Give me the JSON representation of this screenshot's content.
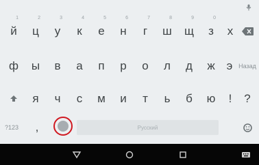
{
  "keyboard": {
    "row1": [
      {
        "label": "й",
        "hint": "1"
      },
      {
        "label": "ц",
        "hint": "2"
      },
      {
        "label": "у",
        "hint": "3"
      },
      {
        "label": "к",
        "hint": "4"
      },
      {
        "label": "е",
        "hint": "5"
      },
      {
        "label": "н",
        "hint": "6"
      },
      {
        "label": "г",
        "hint": "7"
      },
      {
        "label": "ш",
        "hint": "8"
      },
      {
        "label": "щ",
        "hint": "9"
      },
      {
        "label": "з",
        "hint": "0"
      },
      {
        "label": "х",
        "hint": ""
      }
    ],
    "row2": [
      "ф",
      "ы",
      "в",
      "а",
      "п",
      "р",
      "о",
      "л",
      "д",
      "ж",
      "э"
    ],
    "row2_action": "Назад",
    "row3": [
      "я",
      "ч",
      "с",
      "м",
      "и",
      "т",
      "ь",
      "б",
      "ю"
    ],
    "row3_extra": [
      "!",
      "?"
    ],
    "mode_key": "?123",
    "comma": ",",
    "space_label": "Русский",
    "accent": "#d01820"
  },
  "nav_bar": {
    "icons": [
      "back-icon",
      "home-icon",
      "recents-icon",
      "keyboard-icon"
    ]
  }
}
